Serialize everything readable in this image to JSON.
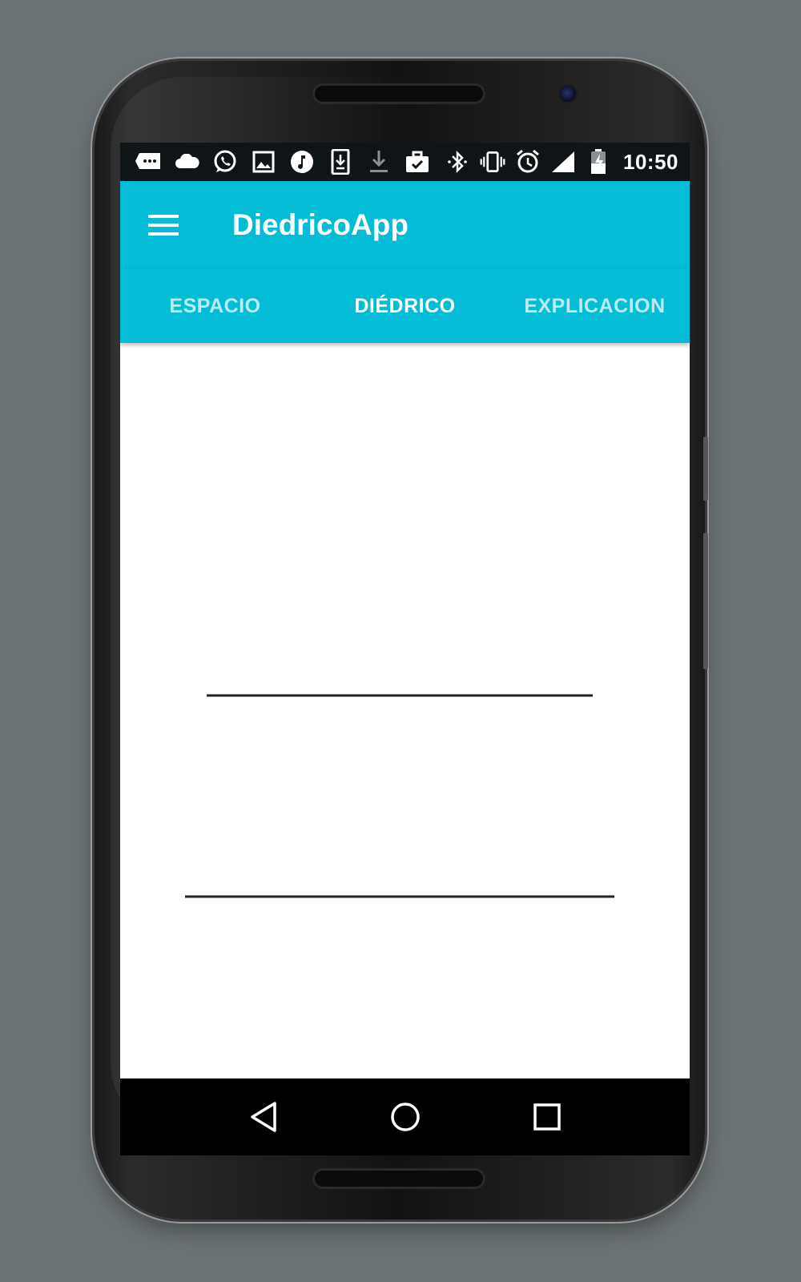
{
  "status_bar": {
    "time": "10:50",
    "left_icons": [
      "message-icon",
      "cloud-icon",
      "whatsapp-icon",
      "image-icon",
      "music-icon",
      "download-icon",
      "download-arrow-icon",
      "work-briefcase-icon"
    ],
    "right_icons": [
      "bluetooth-icon",
      "vibrate-icon",
      "alarm-icon",
      "signal-icon",
      "battery-charging-icon"
    ]
  },
  "app_bar": {
    "title": "DiedricoApp",
    "menu_icon": "hamburger-menu-icon",
    "color": "#04bcd6"
  },
  "tabs": [
    {
      "label": "ESPACIO",
      "active": false
    },
    {
      "label": "DIÉDRICO",
      "active": true
    },
    {
      "label": "EXPLICACION",
      "active": false
    }
  ],
  "nav_bar": {
    "buttons": [
      "back-icon",
      "home-icon",
      "recents-icon"
    ]
  }
}
